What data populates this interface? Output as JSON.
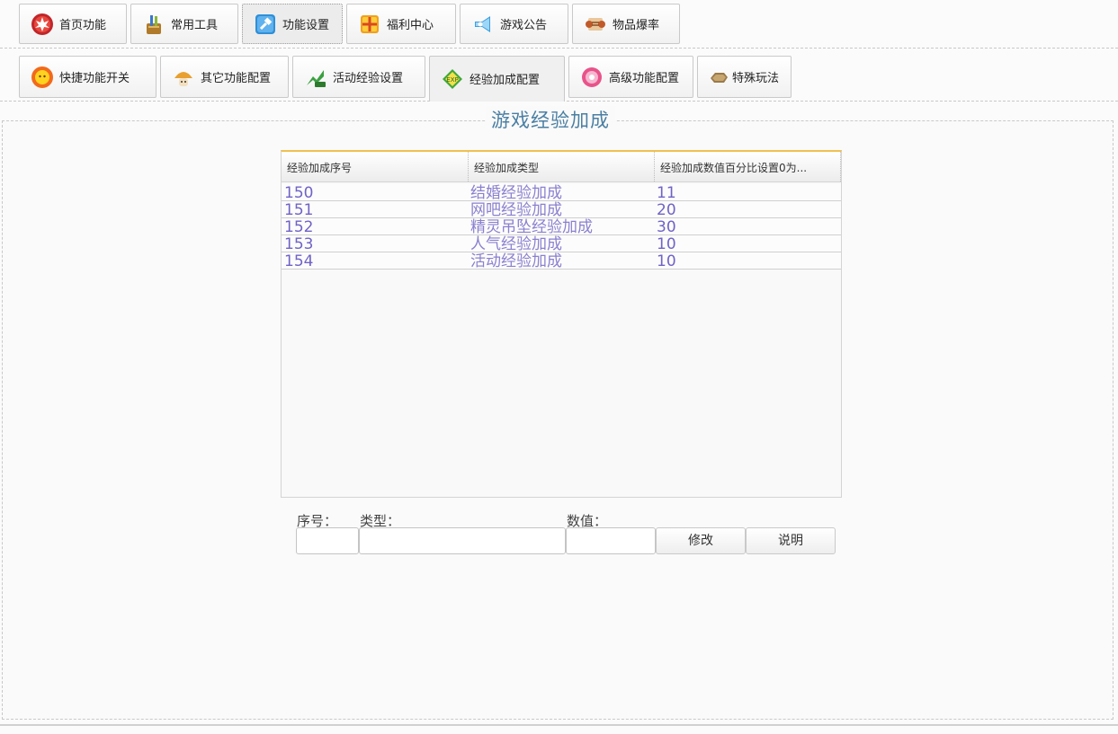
{
  "nav_tabs": [
    {
      "label": "首页功能",
      "icon": "maple-leaf-icon"
    },
    {
      "label": "常用工具",
      "icon": "tool-bag-icon"
    },
    {
      "label": "功能设置",
      "icon": "settings-hammer-icon"
    },
    {
      "label": "福利中心",
      "icon": "gift-icon"
    },
    {
      "label": "游戏公告",
      "icon": "megaphone-icon"
    },
    {
      "label": "物品爆率",
      "icon": "scroll-icon"
    }
  ],
  "nav_active": "功能设置",
  "sub_tabs": [
    {
      "label": "快捷功能开关",
      "icon": "sun-icon"
    },
    {
      "label": "其它功能配置",
      "icon": "mushroom-icon"
    },
    {
      "label": "活动经验设置",
      "icon": "exp-arrow-icon"
    },
    {
      "label": "经验加成配置",
      "icon": "exp-badge-icon"
    },
    {
      "label": "高级功能配置",
      "icon": "pink-orb-icon"
    },
    {
      "label": "特殊玩法",
      "icon": "stone-icon"
    }
  ],
  "sub_active": "经验加成配置",
  "panel": {
    "title": "游戏经验加成"
  },
  "grid": {
    "columns": [
      "经验加成序号",
      "经验加成类型",
      "经验加成数值百分比设置0为..."
    ],
    "rows": [
      [
        "150",
        "结婚经验加成",
        "11"
      ],
      [
        "151",
        "网吧经验加成",
        "20"
      ],
      [
        "152",
        "精灵吊坠经验加成",
        "30"
      ],
      [
        "153",
        "人气经验加成",
        "10"
      ],
      [
        "154",
        "活动经验加成",
        "10"
      ]
    ]
  },
  "form": {
    "id_label": "序号：",
    "type_label": "类型：",
    "value_label": "数值：",
    "id_value": "",
    "type_value": "",
    "value_value": "",
    "modify_button": "修改",
    "help_button": "说明"
  },
  "colors": {
    "title": "#4a7fa3",
    "cell_text": "#6f63c6",
    "grid_accent": "#f0c050"
  }
}
